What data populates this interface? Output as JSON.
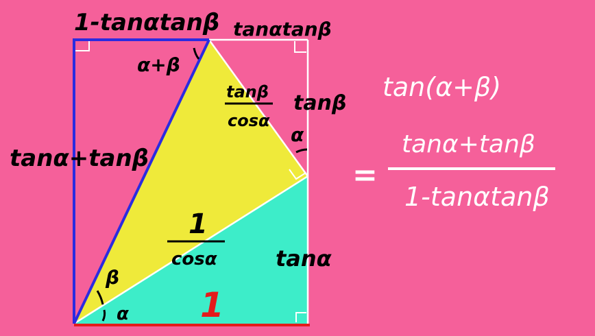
{
  "colors": {
    "background": "#F5609A",
    "yellow_triangle": "#EFEA3A",
    "teal_triangle": "#3DEDC9",
    "blue_line": "#2B2BE0",
    "red_line": "#E41B1B",
    "white_line": "#FFFFFF",
    "ink_black": "#000000",
    "ink_white": "#FFFFFF"
  },
  "labels": {
    "top_left": "1-tanαtanβ",
    "top_right": "tanαtanβ",
    "angle_top": "α+β",
    "left_side": "tanα+tanβ",
    "hyp_upper_num": "tanβ",
    "hyp_upper_den": "cosα",
    "right_upper": "tanβ",
    "angle_right": "α",
    "center_num": "1",
    "center_den": "cosα",
    "right_lower": "tanα",
    "angle_beta": "β",
    "angle_alpha": "α",
    "bottom_one": "1"
  },
  "formula": {
    "lhs": "tan(α+β)",
    "equals": "=",
    "numerator": "tanα+tanβ",
    "denominator": "1-tanαtanβ"
  }
}
